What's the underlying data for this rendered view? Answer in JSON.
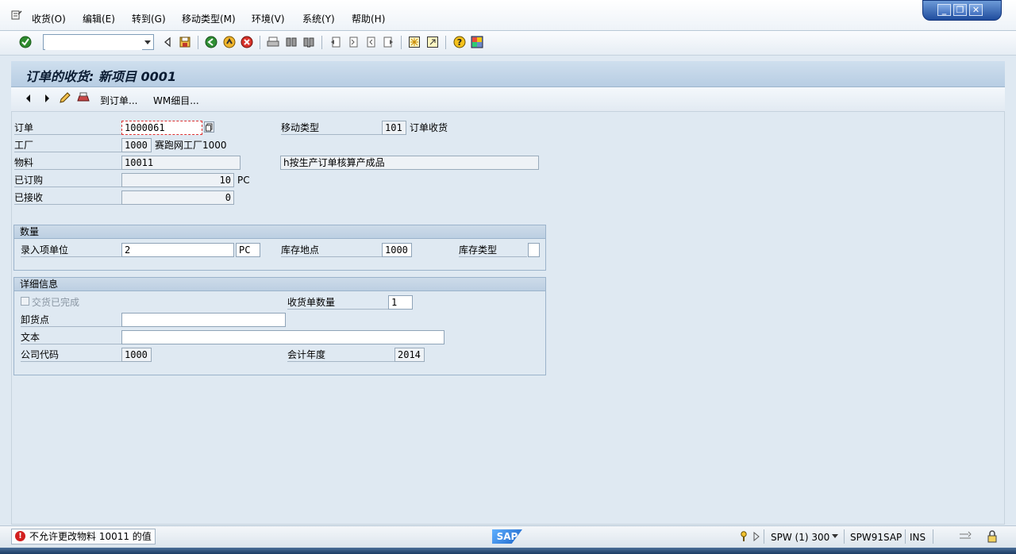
{
  "menubar": {
    "items": [
      "收货(O)",
      "编辑(E)",
      "转到(G)",
      "移动类型(M)",
      "环境(V)",
      "系统(Y)",
      "帮助(H)"
    ]
  },
  "toolbar": {
    "command_field_value": ""
  },
  "screen": {
    "title": "订单的收货: 新项目 0001",
    "app_buttons": [
      "到订单...",
      "WM细目..."
    ]
  },
  "header_fields": {
    "order_label": "订单",
    "order_value": "1000061",
    "plant_label": "工厂",
    "plant_value": "1000",
    "plant_desc": "赛跑网工厂1000",
    "material_label": "物料",
    "material_value": "10011",
    "material_desc": "h按生产订单核算产成品",
    "ordered_label": "已订购",
    "ordered_value": "10",
    "ordered_unit": "PC",
    "received_label": "已接收",
    "received_value": "0",
    "movement_type_label": "移动类型",
    "movement_type_value": "101",
    "movement_type_desc": "订单收货"
  },
  "quantity_group": {
    "title": "数量",
    "entry_unit_label": "录入项单位",
    "entry_unit_value": "2",
    "entry_unit_uom": "PC",
    "storage_loc_label": "库存地点",
    "storage_loc_value": "1000",
    "stock_type_label": "库存类型",
    "stock_type_value": ""
  },
  "detail_group": {
    "title": "详细信息",
    "delivery_completed_label": "交货已完成",
    "gr_slips_label": "收货单数量",
    "gr_slips_value": "1",
    "unloading_point_label": "卸货点",
    "unloading_point_value": "",
    "text_label": "文本",
    "text_value": "",
    "company_code_label": "公司代码",
    "company_code_value": "1000",
    "fiscal_year_label": "会计年度",
    "fiscal_year_value": "2014"
  },
  "statusbar": {
    "message": "不允许更改物料 10011 的值",
    "logo": "SAP",
    "system": "SPW (1) 300",
    "server": "SPW91SAP",
    "mode": "INS"
  },
  "colors": {
    "background": "#dfe9f2",
    "title_bar": "#b7cde3",
    "error_red": "#d21f1f"
  }
}
